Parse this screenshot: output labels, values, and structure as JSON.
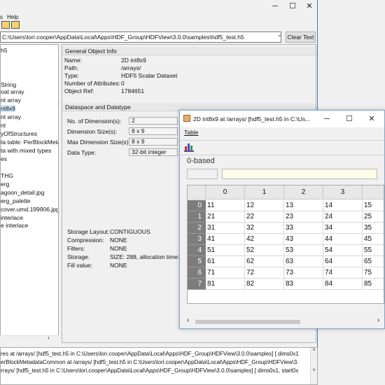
{
  "main": {
    "menu": [
      "s",
      "Help"
    ],
    "path": "C:\\Users\\lori.cooper\\AppData\\Local\\Apps\\HDF_Group\\HDFView\\3.0.0\\samples\\hdf5_test.h5",
    "clear_label": "Clear Text",
    "tree_items": [
      {
        "label": "h5",
        "selected": false
      },
      {
        "label": "String",
        "selected": false
      },
      {
        "label": "oat array",
        "selected": false
      },
      {
        "label": "nt array",
        "selected": false
      },
      {
        "label": "nt8x9",
        "selected": true
      },
      {
        "label": "nt array",
        "selected": false
      },
      {
        "label": "nt",
        "selected": false
      },
      {
        "label": "yOfStructures",
        "selected": false
      },
      {
        "label": "ta table: PerBlockMeta",
        "selected": false
      },
      {
        "label": "ta with mixed types",
        "selected": false
      },
      {
        "label": "es",
        "selected": false
      },
      {
        "label": "THG",
        "selected": false
      },
      {
        "label": "erg",
        "selected": false
      },
      {
        "label": "agoon_detail.jpg",
        "selected": false
      },
      {
        "label": "erg_palette",
        "selected": false
      },
      {
        "label": "cover.umd.199906.jpg",
        "selected": false
      },
      {
        "label": "interlace",
        "selected": false
      },
      {
        "label": "e interlace",
        "selected": false
      }
    ],
    "general": {
      "title": "General Object Info",
      "rows": [
        {
          "label": "Name:",
          "value": "2D int8x9"
        },
        {
          "label": "Path:",
          "value": "/arrays/"
        },
        {
          "label": "Type:",
          "value": "HDF5 Scalar Dataset"
        },
        {
          "label": "Number of Attributes:",
          "value": "0"
        },
        {
          "label": "Object Ref:",
          "value": "1784651"
        }
      ]
    },
    "dataspace": {
      "title": "Dataspace and Datatype",
      "rows": [
        {
          "label": "No. of Dimension(s):",
          "value": "2"
        },
        {
          "label": "Dimension Size(s):",
          "value": "8 x 9"
        },
        {
          "label": "Max Dimension Size(s):",
          "value": "8 x 9"
        },
        {
          "label": "Data Type:",
          "value": "32-bit integer"
        }
      ]
    },
    "storage": {
      "rows": [
        {
          "label": "Storage Layout:",
          "value": "CONTIGUOUS"
        },
        {
          "label": "Compression:",
          "value": "NONE"
        },
        {
          "label": "Filters:",
          "value": "NONE"
        },
        {
          "label": "Storage:",
          "value": "SIZE: 288, allocation time:"
        },
        {
          "label": "Fill value:",
          "value": "NONE"
        }
      ]
    },
    "log_lines": [
      "res at /arrays/ [hdf5_test.h5 in C:\\Users\\lori.cooper\\AppData\\Local\\Apps\\HDF_Group\\HDFView\\3.0.0\\samples] [ dims0x1",
      "erBlockMetadataCommon at /arrays/ [hdf5_test.h5 in C:\\Users\\lori.cooper\\AppData\\Local\\Apps\\HDF_Group\\HDFView\\3.",
      "rrays/ [hdf5_test.h5 in C:\\Users\\lori.cooper\\AppData\\Local\\Apps\\HDF_Group\\HDFView\\3.0.0\\samples] [ dims0x1, start0x"
    ]
  },
  "dlg": {
    "title": "2D int8x9  at  /arrays/  [hdf5_test.h5  in  C:\\Us...",
    "menu": "Table",
    "index_base": "0-based",
    "columns": [
      "0",
      "1",
      "2",
      "3",
      ""
    ],
    "rows": [
      {
        "idx": "0",
        "cells": [
          "11",
          "12",
          "13",
          "14",
          "15"
        ]
      },
      {
        "idx": "1",
        "cells": [
          "21",
          "22",
          "23",
          "24",
          "25"
        ]
      },
      {
        "idx": "2",
        "cells": [
          "31",
          "32",
          "33",
          "34",
          "35"
        ]
      },
      {
        "idx": "3",
        "cells": [
          "41",
          "42",
          "43",
          "44",
          "45"
        ]
      },
      {
        "idx": "4",
        "cells": [
          "51",
          "52",
          "53",
          "54",
          "55"
        ]
      },
      {
        "idx": "5",
        "cells": [
          "61",
          "62",
          "63",
          "64",
          "65"
        ]
      },
      {
        "idx": "6",
        "cells": [
          "71",
          "72",
          "73",
          "74",
          "75"
        ]
      },
      {
        "idx": "7",
        "cells": [
          "81",
          "82",
          "83",
          "84",
          "85"
        ]
      }
    ]
  },
  "colors": {
    "accent": "#3c7fb1",
    "selection": "#cce4f7",
    "row_header": "#7d7d7d",
    "cell_editor": "#fdfde9"
  }
}
